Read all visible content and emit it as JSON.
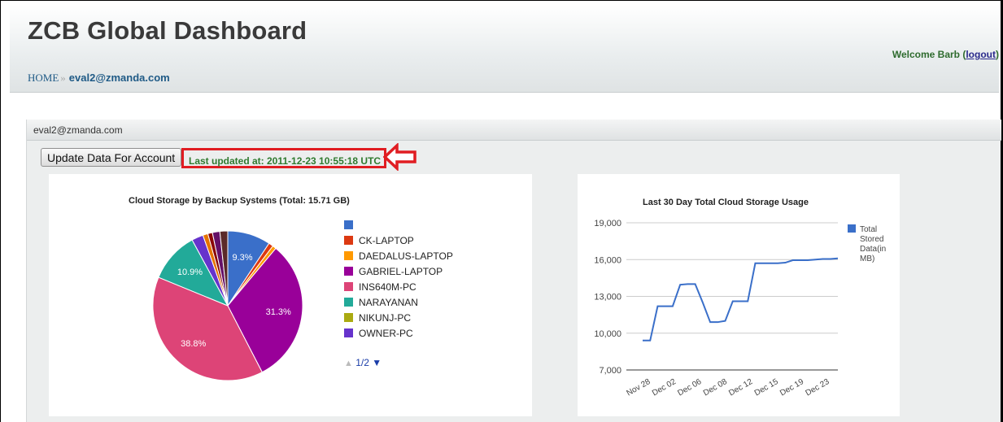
{
  "header": {
    "title": "ZCB Global Dashboard",
    "breadcrumb_home": "HOME",
    "breadcrumb_sep": "»",
    "breadcrumb_account": "eval2@zmanda.com",
    "welcome": "Welcome Barb",
    "logout": "logout"
  },
  "panel": {
    "title": "eval2@zmanda.com",
    "update_button": "Update Data For Account",
    "last_updated": "Last updated at: 2011-12-23 10:55:18 UTC"
  },
  "colors": {
    "highlight": "#e01d22",
    "updated_text": "#2f7a2f",
    "line": "#3a6fc9"
  },
  "pie": {
    "title": "Cloud Storage by Backup Systems (Total: 15.71 GB)",
    "pager": "1/2",
    "chart_data": {
      "type": "pie",
      "title": "Cloud Storage by Backup Systems (Total: 15.71 GB)",
      "slices": [
        {
          "name": "",
          "value": 9.3,
          "color": "#3a6fc9",
          "label": "9.3%"
        },
        {
          "name": "CK-LAPTOP",
          "value": 1.0,
          "color": "#dc3912",
          "label": ""
        },
        {
          "name": "DAEDALUS-LAPTOP",
          "value": 0.8,
          "color": "#ff9900",
          "label": ""
        },
        {
          "name": "GABRIEL-LAPTOP",
          "value": 31.3,
          "color": "#990099",
          "label": "31.3%"
        },
        {
          "name": "INS640M-PC",
          "value": 38.8,
          "color": "#dd4477",
          "label": "38.8%"
        },
        {
          "name": "NARAYANAN",
          "value": 10.9,
          "color": "#22aa99",
          "label": "10.9%"
        },
        {
          "name": "NIKUNJ-PC",
          "value": 0.0,
          "color": "#aaaa11",
          "label": ""
        },
        {
          "name": "OWNER-PC",
          "value": 2.5,
          "color": "#6633cc",
          "label": ""
        },
        {
          "name": "",
          "value": 1.1,
          "color": "#e67300",
          "label": ""
        },
        {
          "name": "",
          "value": 1.0,
          "color": "#8b0707",
          "label": ""
        },
        {
          "name": "",
          "value": 1.6,
          "color": "#651067",
          "label": ""
        },
        {
          "name": "",
          "value": 1.7,
          "color": "#5b2a2a",
          "label": ""
        }
      ],
      "legend_visible": [
        "",
        "CK-LAPTOP",
        "DAEDALUS-LAPTOP",
        "GABRIEL-LAPTOP",
        "INS640M-PC",
        "NARAYANAN",
        "NIKUNJ-PC",
        "OWNER-PC"
      ]
    }
  },
  "line": {
    "title": "Last 30 Day Total Cloud Storage Usage",
    "chart_data": {
      "type": "line",
      "title": "Last 30 Day Total Cloud Storage Usage",
      "xlabel": "",
      "ylabel": "",
      "ylim": [
        7000,
        19000
      ],
      "yticks": [
        "19,000",
        "16,000",
        "13,000",
        "10,000",
        "7,000"
      ],
      "xticks": [
        "Nov 28",
        "Dec 02",
        "Dec 06",
        "Dec 08",
        "Dec 12",
        "Dec 15",
        "Dec 19",
        "Dec 23"
      ],
      "series": [
        {
          "name": "Total Stored Data(in MB)",
          "legend_lines": [
            "Total",
            "Stored",
            "Data(in",
            "MB)"
          ],
          "color": "#3a6fc9",
          "x": [
            0,
            1,
            2,
            3,
            4,
            5,
            6,
            7,
            8,
            9,
            10,
            11,
            12,
            13,
            14,
            15,
            16,
            17,
            18,
            19,
            20,
            21,
            22,
            23,
            24,
            25,
            26
          ],
          "values": [
            9400,
            9400,
            12200,
            12200,
            12200,
            13950,
            14000,
            14000,
            12500,
            10900,
            10900,
            11000,
            12600,
            12600,
            12600,
            15700,
            15700,
            15700,
            15700,
            15750,
            15950,
            15950,
            15950,
            16000,
            16050,
            16050,
            16100
          ]
        }
      ],
      "grid": true
    }
  }
}
